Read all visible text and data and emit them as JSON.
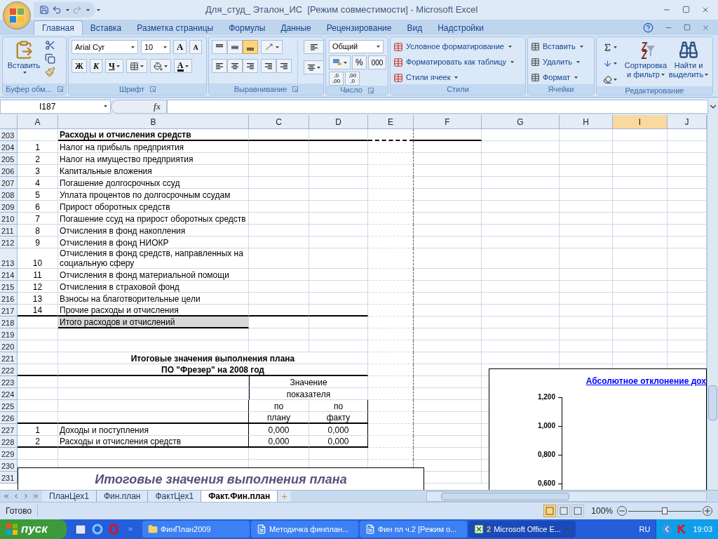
{
  "window": {
    "title": "Для_студ_ Эталон_ИС  [Режим совместимости] - Microsoft Excel"
  },
  "ribbon_tabs": [
    {
      "label": "Главная",
      "selected": true
    },
    {
      "label": "Вставка",
      "selected": false
    },
    {
      "label": "Разметка страницы",
      "selected": false
    },
    {
      "label": "Формулы",
      "selected": false
    },
    {
      "label": "Данные",
      "selected": false
    },
    {
      "label": "Рецензирование",
      "selected": false
    },
    {
      "label": "Вид",
      "selected": false
    },
    {
      "label": "Надстройки",
      "selected": false
    }
  ],
  "clipboard": {
    "label": "Буфер обм...",
    "paste": "Вставить"
  },
  "font": {
    "label": "Шрифт",
    "name": "Arial Cyr",
    "size": "10",
    "grow": "A",
    "shrink": "A",
    "bold": "Ж",
    "italic": "К",
    "underline": "Ч",
    "color_button": "A"
  },
  "alignment": {
    "label": "Выравнивание",
    "vertical": [
      {
        "selected": false
      },
      {
        "selected": false
      },
      {
        "selected": true
      }
    ]
  },
  "number": {
    "label": "Число",
    "format": "Общий",
    "percent": "%",
    "thousands": "000",
    "more_decimals": ",0\n,00",
    "less_decimals": ",00\n,0"
  },
  "styles": {
    "label": "Стили",
    "items": [
      "Условное форматирование",
      "Форматировать как таблицу",
      "Стили ячеек"
    ]
  },
  "cells": {
    "label": "Ячейки",
    "items": [
      "Вставить",
      "Удалить",
      "Формат"
    ]
  },
  "editing": {
    "label": "Редактирование",
    "sort": [
      "Сортировка",
      "и фильтр"
    ],
    "find": [
      "Найти и",
      "выделить"
    ]
  },
  "formula_bar": {
    "name_box": "I187",
    "fx": "fx"
  },
  "columns": [
    {
      "label": "A",
      "selected": false
    },
    {
      "label": "B",
      "selected": false
    },
    {
      "label": "C",
      "selected": false
    },
    {
      "label": "D",
      "selected": false
    },
    {
      "label": "E",
      "selected": false
    },
    {
      "label": "F",
      "selected": false
    },
    {
      "label": "G",
      "selected": false
    },
    {
      "label": "H",
      "selected": false
    },
    {
      "label": "I",
      "selected": true
    },
    {
      "label": "J",
      "selected": false
    }
  ],
  "rows": [
    {
      "num": "203",
      "kind": "section",
      "rule_below": true,
      "b": "Расходы и отчисления средств"
    },
    {
      "num": "204",
      "kind": "item",
      "rule_below": false,
      "a": "1",
      "b": "Налог на прибыль предприятия"
    },
    {
      "num": "205",
      "kind": "item",
      "rule_below": false,
      "a": "2",
      "b": "Налог на имущество предприятия"
    },
    {
      "num": "206",
      "kind": "item",
      "rule_below": false,
      "a": "3",
      "b": "Капитальные вложения"
    },
    {
      "num": "207",
      "kind": "item",
      "rule_below": false,
      "a": "4",
      "b": "Погашение долгосрочных ссуд"
    },
    {
      "num": "208",
      "kind": "item",
      "rule_below": false,
      "a": "5",
      "b": "Уплата процентов по долгосрочным ссудам"
    },
    {
      "num": "209",
      "kind": "item",
      "rule_below": false,
      "a": "6",
      "b": "Прирост оборотных средств"
    },
    {
      "num": "210",
      "kind": "item",
      "rule_below": false,
      "a": "7",
      "b": "Погашение ссуд на прирост оборотных средств"
    },
    {
      "num": "211",
      "kind": "item",
      "rule_below": false,
      "a": "8",
      "b": "Отчисления в фонд накопления"
    },
    {
      "num": "212",
      "kind": "item",
      "rule_below": false,
      "a": "9",
      "b": "Отчисления в фонд НИОКР"
    },
    {
      "num": "213",
      "kind": "item",
      "rule_below": false,
      "a": "10",
      "b": "Отчисления в фонд средств, направленных на социальную сферу"
    },
    {
      "num": "214",
      "kind": "item",
      "rule_below": false,
      "a": "11",
      "b": "Отчисления в фонд материальной помощи"
    },
    {
      "num": "215",
      "kind": "item",
      "rule_below": false,
      "a": "12",
      "b": "Отчисления в страховой фонд"
    },
    {
      "num": "216",
      "kind": "item",
      "rule_below": false,
      "a": "13",
      "b": "Взносы на благотворительные цели"
    },
    {
      "num": "217",
      "kind": "item",
      "rule_below": true,
      "a": "14",
      "b": "Прочие расходы и отчисления"
    },
    {
      "num": "218",
      "kind": "total",
      "rule_below": true,
      "b": "Итого расходов и отчислений"
    },
    {
      "num": "219",
      "kind": "blank",
      "rule_below": false
    },
    {
      "num": "220",
      "kind": "blank",
      "rule_below": false
    },
    {
      "num": "221",
      "kind": "heading",
      "rule_below": false,
      "text": "Итоговые значения выполнения плана"
    },
    {
      "num": "222",
      "kind": "heading",
      "rule_below": true,
      "text": "ПО \"Фрезер\" на 2008 год"
    },
    {
      "num": "223",
      "kind": "value_header",
      "rule_below": false,
      "text": "Значение"
    },
    {
      "num": "224",
      "kind": "value_header",
      "rule_below": false,
      "text": "показателя"
    },
    {
      "num": "225",
      "kind": "values",
      "rule_below": false,
      "c": "по",
      "d": "по"
    },
    {
      "num": "226",
      "kind": "values",
      "rule_below": true,
      "c": "плану",
      "d": "факту"
    },
    {
      "num": "227",
      "kind": "values",
      "rule_below": false,
      "a": "1",
      "b": "Доходы и поступления",
      "c": "0,000",
      "d": "0,000"
    },
    {
      "num": "228",
      "kind": "values",
      "rule_below": true,
      "a": "2",
      "b": "Расходы и отчисления средств",
      "c": "0,000",
      "d": "0,000"
    },
    {
      "num": "229",
      "kind": "blank",
      "rule_below": false
    },
    {
      "num": "230",
      "kind": "blank",
      "rule_below": false
    },
    {
      "num": "231",
      "kind": "blank",
      "rule_below": false
    }
  ],
  "text_box": {
    "text": "Итоговые значения выполнения плана"
  },
  "chart": {
    "title": "Абсолютное отклонение дох",
    "y_tick_labels": [
      "1,200",
      "1,000",
      "0,800",
      "0,600"
    ]
  },
  "sheet_tabs": [
    {
      "label": "ПланЦех1",
      "selected": false
    },
    {
      "label": "Фин.план",
      "selected": false
    },
    {
      "label": "ФактЦех1",
      "selected": false
    },
    {
      "label": "Факт.Фин.план",
      "selected": true
    }
  ],
  "status_bar": {
    "text": "Готово",
    "views": [
      {
        "selected": true
      },
      {
        "selected": false
      },
      {
        "selected": false
      }
    ],
    "zoom": "100%",
    "zoom_level": {
      "level": 0.5
    }
  },
  "taskbar": {
    "start": "пуск",
    "tasks": [
      {
        "label": "ФинПлан2009",
        "kind": "folder",
        "selected": false
      },
      {
        "label": "Методичка финплан...",
        "kind": "word",
        "selected": false
      },
      {
        "label": "Фин пл ч.2 [Режим о...",
        "kind": "word",
        "selected": false
      },
      {
        "label": "Microsoft Office E...",
        "count": "2",
        "kind": "excel",
        "selected": true
      }
    ],
    "language": "RU",
    "clock": "19:03"
  }
}
